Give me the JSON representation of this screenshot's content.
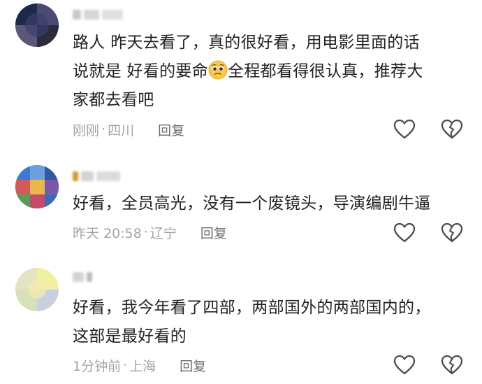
{
  "comments": [
    {
      "body_lines": [
        "路人 昨天去看了，真的很好看，用电影里面的话",
        "说就是 好看的要命",
        "全程都看得很认真，推荐大",
        "家都去看吧"
      ],
      "time": "刚刚",
      "location": "四川",
      "reply_label": "回复",
      "emoji_icon": "pleading-face-emoji",
      "avatar_colors": [
        "#1e2a4a",
        "#3a3f6b",
        "#55507a",
        "#2b2b3a",
        "#6b6a8a",
        "#1c1c2c"
      ]
    },
    {
      "body_lines": [
        "好看，全员高光，没有一个废镜头，导演编剧牛逼"
      ],
      "time": "昨天 20:58",
      "location": "辽宁",
      "reply_label": "回复",
      "avatar_colors": [
        "#3c7bd1",
        "#d45a5a",
        "#e8b84a",
        "#5a9b5a",
        "#7a5aa8",
        "#2d5aa0"
      ]
    },
    {
      "body_lines": [
        "好看，我今年看了四部，两部国外的两部国内的，",
        "这部是最好看的"
      ],
      "time": "1分钟前",
      "location": "上海",
      "reply_label": "回复",
      "avatar_colors": [
        "#e8e8c8",
        "#f0f0a0",
        "#d8e0b8",
        "#c8d0e0",
        "#f4e8b0",
        "#e0e0d0"
      ]
    }
  ],
  "meta_separator": "·",
  "icons": {
    "like": "heart-outline-icon",
    "dislike": "broken-heart-outline-icon"
  }
}
